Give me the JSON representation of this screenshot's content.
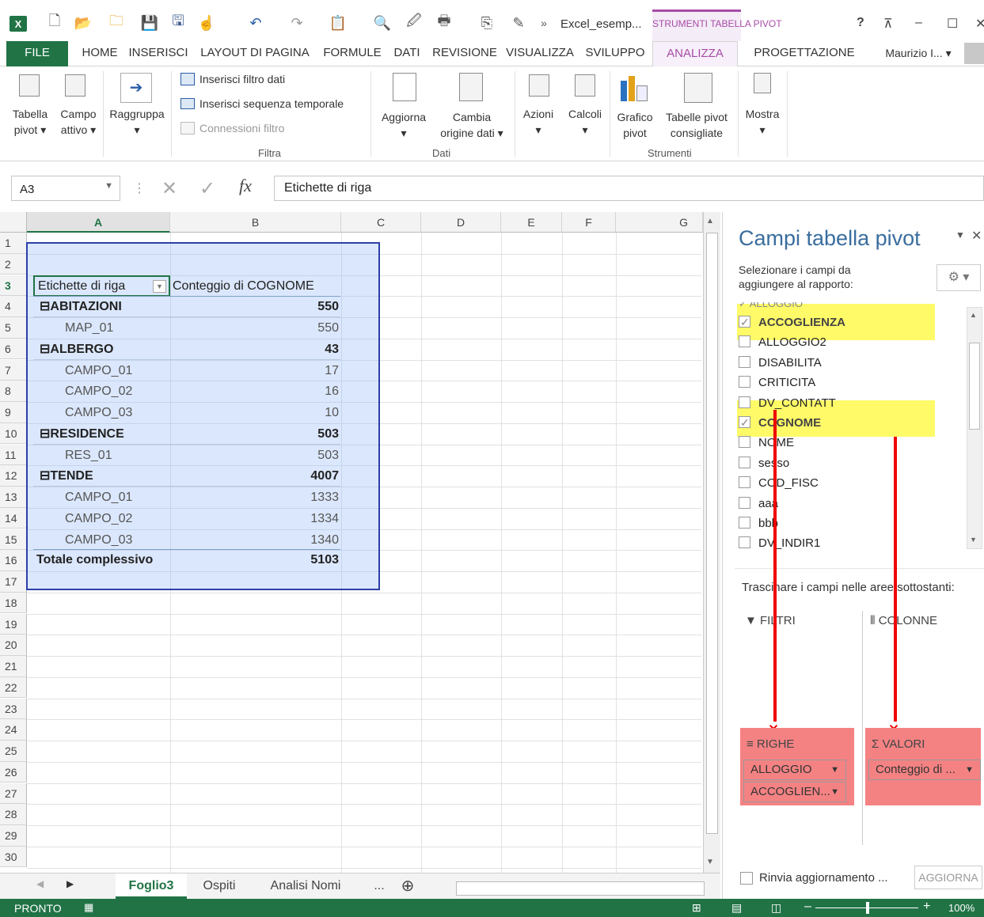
{
  "window": {
    "doc_title": "Excel_esemp...",
    "context_title": "STRUMENTI TABELLA PIVOT",
    "help": "?",
    "icons": [
      "excel-logo-icon",
      "new-file-icon",
      "open-folder-icon",
      "folder-star-icon",
      "save-icon",
      "save-as-icon",
      "touch-mode-icon",
      "undo-icon",
      "redo-icon",
      "paste-special-icon",
      "print-preview-icon",
      "publish-icon",
      "print-icon",
      "copy-icon",
      "format-painter-icon"
    ],
    "logo_text": "X"
  },
  "menu": {
    "tabs": [
      "FILE",
      "HOME",
      "INSERISCI",
      "LAYOUT DI PAGINA",
      "FORMULE",
      "DATI",
      "REVISIONE",
      "VISUALIZZA",
      "SVILUPPO",
      "ANALIZZA",
      "PROGETTAZIONE"
    ],
    "user": "Maurizio I... ▾"
  },
  "ribbon": {
    "tabella_pivot": [
      "Tabella",
      "pivot ▾"
    ],
    "campo_attivo": [
      "Campo",
      "attivo ▾"
    ],
    "raggruppa": [
      "Raggruppa",
      "▾"
    ],
    "filtra_items": [
      "Inserisci filtro dati",
      "Inserisci sequenza temporale",
      "Connessioni filtro"
    ],
    "filtra_group": "Filtra",
    "aggiorna": [
      "Aggiorna",
      "▾"
    ],
    "cambia": [
      "Cambia",
      "origine dati ▾"
    ],
    "dati_group": "Dati",
    "azioni": [
      "Azioni",
      "▾"
    ],
    "calcoli": [
      "Calcoli",
      "▾"
    ],
    "grafico": [
      "Grafico",
      "pivot"
    ],
    "tabelle": [
      "Tabelle pivot",
      "consigliate"
    ],
    "strumenti_group": "Strumenti",
    "mostra": [
      "Mostra",
      "▾"
    ]
  },
  "formula_bar": {
    "name_box": "A3",
    "fx": "fx",
    "content": "Etichette di riga"
  },
  "columns": [
    "A",
    "B",
    "C",
    "D",
    "E",
    "F",
    "G"
  ],
  "rows": [
    "1",
    "2",
    "3",
    "4",
    "5",
    "6",
    "7",
    "8",
    "9",
    "10",
    "11",
    "12",
    "13",
    "14",
    "15",
    "16",
    "17",
    "18",
    "19",
    "20",
    "21",
    "22",
    "23",
    "24",
    "25",
    "26",
    "27",
    "28",
    "29",
    "30"
  ],
  "pivot": {
    "header_label": "Etichette di riga",
    "header_value": "Conteggio di COGNOME",
    "rows": [
      {
        "label": "⊟ABITAZIONI",
        "value": "550",
        "level": 0
      },
      {
        "label": "MAP_01",
        "value": "550",
        "level": 1
      },
      {
        "label": "⊟ALBERGO",
        "value": "43",
        "level": 0
      },
      {
        "label": "CAMPO_01",
        "value": "17",
        "level": 1
      },
      {
        "label": "CAMPO_02",
        "value": "16",
        "level": 1
      },
      {
        "label": "CAMPO_03",
        "value": "10",
        "level": 1
      },
      {
        "label": "⊟RESIDENCE",
        "value": "503",
        "level": 0
      },
      {
        "label": "RES_01",
        "value": "503",
        "level": 1
      },
      {
        "label": "⊟TENDE",
        "value": "4007",
        "level": 0
      },
      {
        "label": "CAMPO_01",
        "value": "1333",
        "level": 1
      },
      {
        "label": "CAMPO_02",
        "value": "1334",
        "level": 1
      },
      {
        "label": "CAMPO_03",
        "value": "1340",
        "level": 1
      }
    ],
    "total_label": "Totale complessivo",
    "total_value": "5103"
  },
  "sheet_tabs": [
    "Foglio3",
    "Ospiti",
    "Analisi Nomi",
    "..."
  ],
  "status": {
    "text": "PRONTO",
    "zoom": "100%"
  },
  "pivot_panel": {
    "title": "Campi tabella pivot",
    "instruction": "Selezionare i campi da aggiungere al rapporto:",
    "fields": [
      {
        "name": "ACCOGLIENZA",
        "checked": true,
        "bold": true
      },
      {
        "name": "ALLOGGIO2",
        "checked": false
      },
      {
        "name": "DISABILITA",
        "checked": false
      },
      {
        "name": "CRITICITA",
        "checked": false
      },
      {
        "name": "DV_CONTATT",
        "checked": false
      },
      {
        "name": "COGNOME",
        "checked": true,
        "bold": true
      },
      {
        "name": "NOME",
        "checked": false
      },
      {
        "name": "sesso",
        "checked": false
      },
      {
        "name": "COD_FISC",
        "checked": false
      },
      {
        "name": "aaa",
        "checked": false
      },
      {
        "name": "bbb",
        "checked": false
      },
      {
        "name": "DV_INDIR1",
        "checked": false
      }
    ],
    "drag_text": "Trascinare i campi nelle aree sottostanti:",
    "filtri": "FILTRI",
    "colonne": "COLONNE",
    "righe": "RIGHE",
    "valori": "VALORI",
    "righe_items": [
      "ALLOGGIO",
      "ACCOGLIEN..."
    ],
    "valori_items": [
      "Conteggio di ..."
    ],
    "defer": "Rinvia aggiornamento ...",
    "update_button": "AGGIORNA"
  }
}
